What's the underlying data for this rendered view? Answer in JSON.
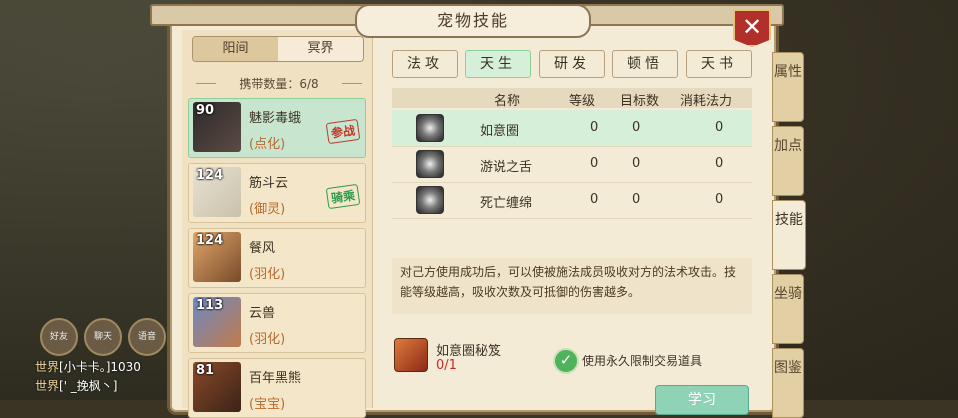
{
  "title": "宠物技能",
  "close_label": "✕",
  "realm_tabs": [
    "阳间",
    "冥界"
  ],
  "carry": "携带数量：6/8",
  "pets": [
    {
      "level": "90",
      "name": "魅影毒蛾",
      "type": "(点化)",
      "stamp": "参战",
      "stamp_color": "#c0392b"
    },
    {
      "level": "124",
      "name": "筋斗云",
      "type": "(御灵)",
      "stamp": "骑乘",
      "stamp_color": "#2e9a4c"
    },
    {
      "level": "124",
      "name": "餐风",
      "type": "(羽化)",
      "stamp": ""
    },
    {
      "level": "113",
      "name": "云兽",
      "type": "(羽化)",
      "stamp": ""
    },
    {
      "level": "81",
      "name": "百年黑熊",
      "type": "(宝宝)",
      "stamp": ""
    }
  ],
  "skill_tabs": [
    "法攻",
    "天生",
    "研发",
    "顿悟",
    "天书"
  ],
  "active_skill_tab": 1,
  "table": {
    "headers": [
      "名称",
      "等级",
      "目标数",
      "消耗法力"
    ],
    "rows": [
      {
        "name": "如意圈",
        "level": "0",
        "targets": "0",
        "mana": "0"
      },
      {
        "name": "游说之舌",
        "level": "0",
        "targets": "0",
        "mana": "0"
      },
      {
        "name": "死亡缠绵",
        "level": "0",
        "targets": "0",
        "mana": "0"
      }
    ]
  },
  "description": "对己方使用成功后，可以使被施法成员吸收对方的法术攻击。技能等级越高，吸收次数及可抵御的伤害越多。",
  "book": {
    "name": "如意圈秘笈",
    "count": "0/1"
  },
  "use_permanent_label": "使用永久限制交易道具",
  "learn_label": "学习",
  "side_tabs": [
    "属性",
    "加点",
    "技能",
    "坐骑",
    "图鉴"
  ],
  "active_side_tab": 2,
  "chat": [
    {
      "channel": "世界",
      "text": "[小卡卡。]1030"
    },
    {
      "channel": "世界",
      "text": "[' _挽枫丶]"
    }
  ],
  "hud": [
    "好友",
    "聊天",
    "语音"
  ]
}
